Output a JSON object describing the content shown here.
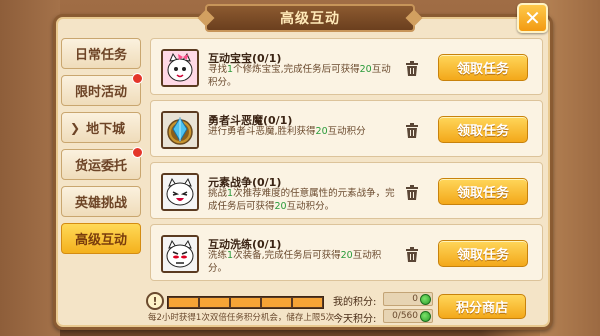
{
  "window": {
    "title": "高级互动",
    "close_label": "✕"
  },
  "tabs": [
    {
      "label": "日常任务",
      "active": false,
      "dot": false
    },
    {
      "label": "限时活动",
      "active": false,
      "dot": true
    },
    {
      "label": "地下城",
      "active": false,
      "dot": false,
      "arrow": "❯"
    },
    {
      "label": "货运委托",
      "active": false,
      "dot": true
    },
    {
      "label": "英雄挑战",
      "active": false,
      "dot": false
    },
    {
      "label": "高级互动",
      "active": true,
      "dot": false
    }
  ],
  "tasks": [
    {
      "title": "互动宝宝(0/1)",
      "desc_pre": "寻找",
      "desc_n1": "1",
      "desc_mid": "个修炼宝宝,完成任务后可获得",
      "desc_n2": "20",
      "desc_post": "互动积分。",
      "button": "领取任务",
      "icon": "cat-pink-bow-icon"
    },
    {
      "title": "勇者斗恶魔(0/1)",
      "desc_pre": "进行勇者斗恶魔,胜利获得",
      "desc_n1": "",
      "desc_mid": "",
      "desc_n2": "20",
      "desc_post": "互动积分",
      "button": "领取任务",
      "icon": "crystal-badge-icon"
    },
    {
      "title": "元素战争(0/1)",
      "desc_pre": "挑战",
      "desc_n1": "1",
      "desc_mid": "次推荐难度的任意属性的元素战争，完成任务后可获得",
      "desc_n2": "20",
      "desc_post": "互动积分。",
      "button": "领取任务",
      "icon": "cat-laughing-icon"
    },
    {
      "title": "互动洗练(0/1)",
      "desc_pre": "洗练",
      "desc_n1": "1",
      "desc_mid": "次装备,完成任务后可获得",
      "desc_n2": "20",
      "desc_post": "互动积分。",
      "button": "领取任务",
      "icon": "cat-angry-icon"
    }
  ],
  "footer": {
    "progress_fraction": 1.0,
    "note": "每2小时获得1次双倍任务积分机会，储存上限5次",
    "my_points_label": "我的积分:",
    "my_points_value": "0",
    "today_points_label": "今天积分:",
    "today_points_value": "0/560",
    "shop_button": "积分商店"
  },
  "colors": {
    "accent": "#f3a81a",
    "highlight": "#2a9a3a",
    "dot": "#e4362a"
  }
}
